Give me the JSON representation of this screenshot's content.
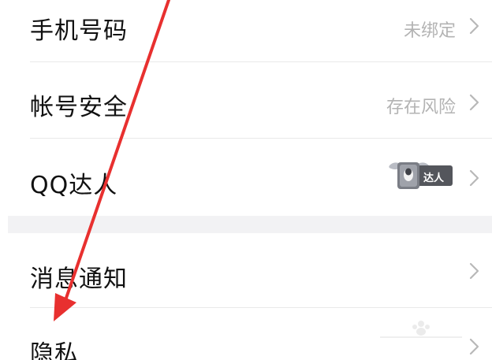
{
  "settings": {
    "rows": [
      {
        "label": "手机号码",
        "value": "未绑定",
        "icon": "chevron-right-icon"
      },
      {
        "label": "帐号安全",
        "value": "存在风险",
        "icon": "chevron-right-icon"
      },
      {
        "label": "QQ达人",
        "badge_text": "达人",
        "icon": "chevron-right-icon"
      },
      {
        "label": "消息通知",
        "icon": "chevron-right-icon"
      },
      {
        "label": "隐私",
        "icon": "chevron-right-icon"
      }
    ]
  },
  "annotation": {
    "arrow_color": "#e8302f"
  },
  "colors": {
    "text": "#111111",
    "secondary": "#b3b3b3",
    "divider": "#e9e9e9",
    "section_gap": "#f2f2f4"
  }
}
